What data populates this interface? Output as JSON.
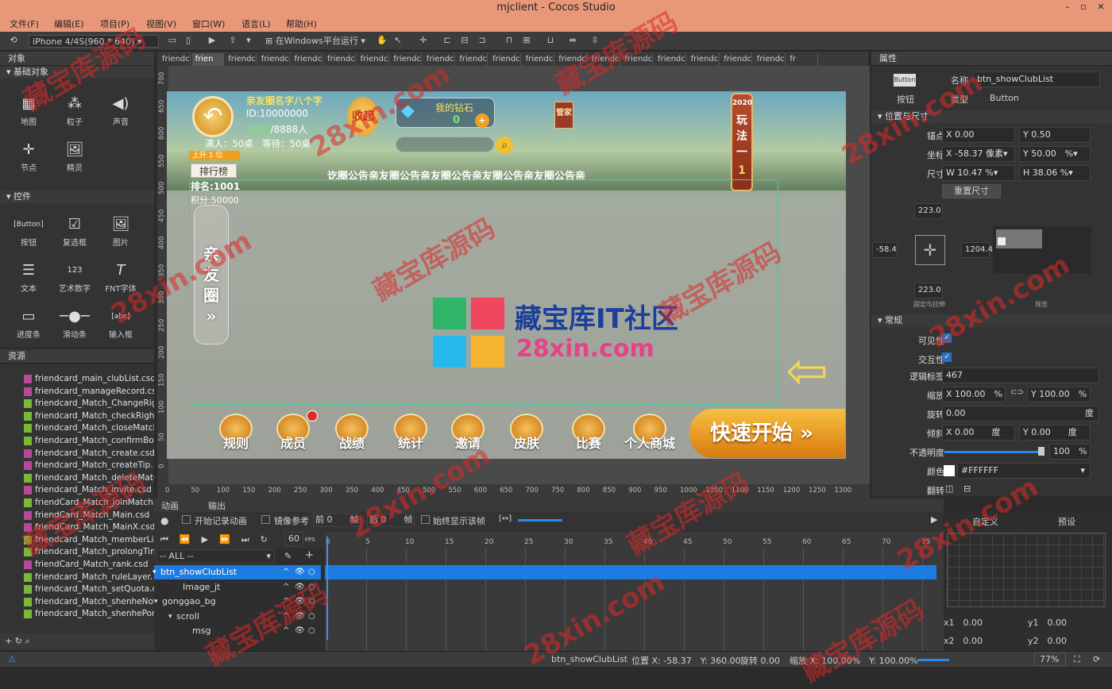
{
  "window": {
    "title": "mjclient - Cocos Studio"
  },
  "menu": [
    "文件(F)",
    "编辑(E)",
    "项目(P)",
    "视图(V)",
    "窗口(W)",
    "语言(L)",
    "帮助(H)"
  ],
  "toolbar": {
    "device": "iPhone 4/4S(960 * 640)",
    "run_target": "在Windows平台运行"
  },
  "objects_panel": {
    "title": "对象",
    "section_basic": "基础对象",
    "section_controls": "控件",
    "basic": [
      "地图",
      "粒子",
      "声音",
      "节点",
      "精灵"
    ],
    "controls": [
      "按钮",
      "复选框",
      "图片",
      "文本",
      "艺术数字",
      "FNT字体",
      "进度条",
      "滑动条",
      "输入框"
    ]
  },
  "resources_panel": {
    "title": "资源",
    "files": [
      {
        "name": "friendcard_main_clubList.csd",
        "kind": "csd"
      },
      {
        "name": "friendcard_manageRecord.csd",
        "kind": "csd"
      },
      {
        "name": "friendcard_Match_ChangeRig",
        "kind": "png"
      },
      {
        "name": "friendcard_Match_checkRight",
        "kind": "png"
      },
      {
        "name": "friendcard_Match_closeMatch",
        "kind": "png"
      },
      {
        "name": "friendcard_Match_confirmBox",
        "kind": "png"
      },
      {
        "name": "friendcard_Match_create.csd",
        "kind": "csd"
      },
      {
        "name": "friendcard_Match_createTip.",
        "kind": "csd"
      },
      {
        "name": "friendcard_Match_deleteMatc",
        "kind": "png"
      },
      {
        "name": "friendcard_Match_invite.csd",
        "kind": "csd"
      },
      {
        "name": "friendCard_Match_joinMatch.",
        "kind": "png"
      },
      {
        "name": "friendCard_Match_Main.csd",
        "kind": "csd"
      },
      {
        "name": "friendCard_Match_MainX.csd",
        "kind": "csd"
      },
      {
        "name": "friendcard_Match_memberLis",
        "kind": "png"
      },
      {
        "name": "friendcard_Match_prolongTim",
        "kind": "png"
      },
      {
        "name": "friendCard_Match_rank.csd",
        "kind": "csd"
      },
      {
        "name": "friendcard_Match_ruleLayer.",
        "kind": "png"
      },
      {
        "name": "friendcard_Match_setQuota.c",
        "kind": "png"
      },
      {
        "name": "friendcard_Match_shenheNot",
        "kind": "png"
      },
      {
        "name": "friendcard_Match_shenhePon",
        "kind": "png"
      }
    ]
  },
  "doc_tabs": [
    "friendc",
    "frien",
    "friendca",
    "friendca",
    "friendca",
    "friendca",
    "friendca",
    "friendca",
    "friendca",
    "friendca",
    "friendca",
    "friendca",
    "friendca",
    "friendca",
    "friendca",
    "friendca",
    "friendca",
    "friendca",
    "friendca",
    "fr"
  ],
  "game": {
    "club_name": "亲友圈名字八个字",
    "club_id": "ID:10000000",
    "members_num": "8888",
    "members_total": "/8888人",
    "tables": "满人：50桌　等待：50桌",
    "collapse": "收起",
    "diamond_label": "我的钻石",
    "diamond_value": "0",
    "manage": "管家",
    "ranking": "排行榜",
    "rank_up": "上升 1 位",
    "rank": "排名:1001",
    "score": "积分:50000",
    "notice": "讫圈公告亲友圈公告亲友圈公告亲友圈公告亲友圈公告亲",
    "side_tab": [
      "亲",
      "友",
      "圈",
      "»"
    ],
    "rule_tag": [
      "2020",
      "玩",
      "法",
      "一",
      "1"
    ],
    "bottom": [
      "规则",
      "成员",
      "战绩",
      "统计",
      "邀请",
      "皮肤",
      "比赛",
      "个人商城"
    ],
    "quick_start": "快速开始",
    "logo_cn": "藏宝库IT社区",
    "logo_en": "28xin.com"
  },
  "ruler_left": [
    "700",
    "650",
    "600",
    "550",
    "500",
    "450",
    "400",
    "350",
    "300",
    "250",
    "200",
    "150",
    "100",
    "50",
    "0"
  ],
  "ruler_bottom": [
    "0",
    "50",
    "100",
    "150",
    "200",
    "250",
    "300",
    "350",
    "400",
    "450",
    "500",
    "550",
    "600",
    "650",
    "700",
    "750",
    "800",
    "850",
    "900",
    "950",
    "1000",
    "1050",
    "1100",
    "1150",
    "1200",
    "1250",
    "1300"
  ],
  "properties": {
    "title": "属性",
    "widget_label": "按钮",
    "name_label": "名称",
    "name": "btn_showClubList",
    "type_label": "类型",
    "type": "Button",
    "pos_section": "位置与尺寸",
    "anchor_label": "锚点",
    "anchor_x": "0.00",
    "anchor_y": "0.50",
    "coord_label": "坐标",
    "coord_x": "-58.37",
    "coord_unit": "像素",
    "coord_y": "50.00",
    "coord_y_unit": "%",
    "size_label": "尺寸",
    "size_w": "10.47",
    "size_h": "38.06",
    "reset_size": "重置尺寸",
    "margin_top": "223.0",
    "margin_left": "-58.4",
    "margin_right": "1204.4",
    "margin_bottom": "223.0",
    "layout_label": "固定与拉伸",
    "preview_label": "预览",
    "general_section": "常规",
    "visible_label": "可见性",
    "interact_label": "交互性",
    "tag_label": "逻辑标签",
    "tag": "467",
    "scale_label": "缩放",
    "scale_x": "100.00",
    "scale_y": "100.00",
    "rotate_label": "旋转",
    "rotate": "0.00",
    "rotate_unit": "度",
    "skew_label": "倾斜",
    "skew_x": "0.00",
    "skew_y": "0.00",
    "opacity_label": "不透明度",
    "opacity": "100",
    "opacity_level": 1.0,
    "color_label": "颜色",
    "color": "#FFFFFF",
    "flip_label": "翻转"
  },
  "animation": {
    "tab_anim": "动画",
    "tab_output": "输出",
    "record": "开始记录动画",
    "mirror": "镜像参考",
    "before": "前",
    "before_val": "0",
    "frame": "帧",
    "after": "后",
    "after_val": "0",
    "always_show": "始终显示该帧",
    "fps": "60",
    "fps_unit": "FPS",
    "filter": "-- ALL --",
    "tracks": [
      "btn_showClubList",
      "Image_jt",
      "gonggao_bg",
      "scroll",
      "msg"
    ],
    "ticks": [
      "0",
      "5",
      "10",
      "15",
      "20",
      "25",
      "30",
      "35",
      "40",
      "45",
      "50",
      "55",
      "60",
      "65",
      "70",
      "75"
    ],
    "custom": "自定义",
    "preset": "预设",
    "x1": "x1",
    "x1v": "0.00",
    "y1": "y1",
    "y1v": "0.00",
    "x2": "x2",
    "x2v": "0.00",
    "y2": "y2",
    "y2v": "0.00"
  },
  "status": {
    "selected": "btn_showClubList",
    "pos": "位置 X: -58.37　Y: 360.00",
    "rot": "旋转 0.00",
    "scale": "缩放 X: 100.00%　Y: 100.00%",
    "zoom": "77%"
  },
  "watermark": [
    "藏宝库源码",
    "28xin.com"
  ]
}
